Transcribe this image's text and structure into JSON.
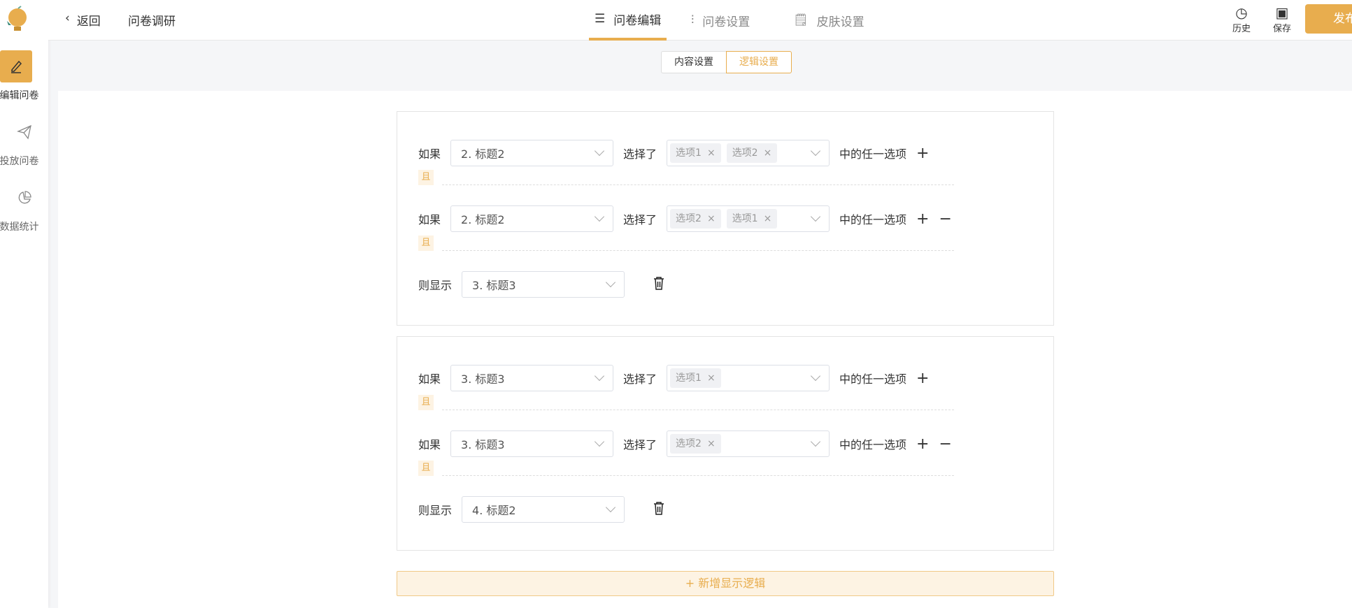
{
  "sidebar": {
    "items": [
      {
        "label": "编辑问卷",
        "active": true
      },
      {
        "label": "投放问卷"
      },
      {
        "label": "数据统计"
      }
    ]
  },
  "header": {
    "back": "返回",
    "title": "问卷调研",
    "tabs": [
      {
        "label": "问卷编辑",
        "active": true
      },
      {
        "label": "问卷设置"
      },
      {
        "label": "皮肤设置"
      }
    ],
    "history": "历史",
    "save": "保存",
    "publish": "发布"
  },
  "subtabs": {
    "content": "内容设置",
    "logic": "逻辑设置",
    "active": "logic"
  },
  "labels": {
    "if": "如果",
    "selected": "选择了",
    "any": "中的任一选项",
    "and": "且",
    "then": "则显示",
    "plus": "+",
    "minus": "−"
  },
  "rules": [
    {
      "conditions": [
        {
          "question": "2. 标题2",
          "options": [
            "选项1",
            "选项2"
          ]
        },
        {
          "question": "2. 标题2",
          "options": [
            "选项2",
            "选项1"
          ]
        }
      ],
      "show": "3. 标题3"
    },
    {
      "conditions": [
        {
          "question": "3. 标题3",
          "options": [
            "选项1"
          ]
        },
        {
          "question": "3. 标题3",
          "options": [
            "选项2"
          ]
        }
      ],
      "show": "4. 标题2"
    }
  ],
  "add_logic": "+ 新增显示逻辑",
  "colors": {
    "accent": "#e8ad4e"
  }
}
